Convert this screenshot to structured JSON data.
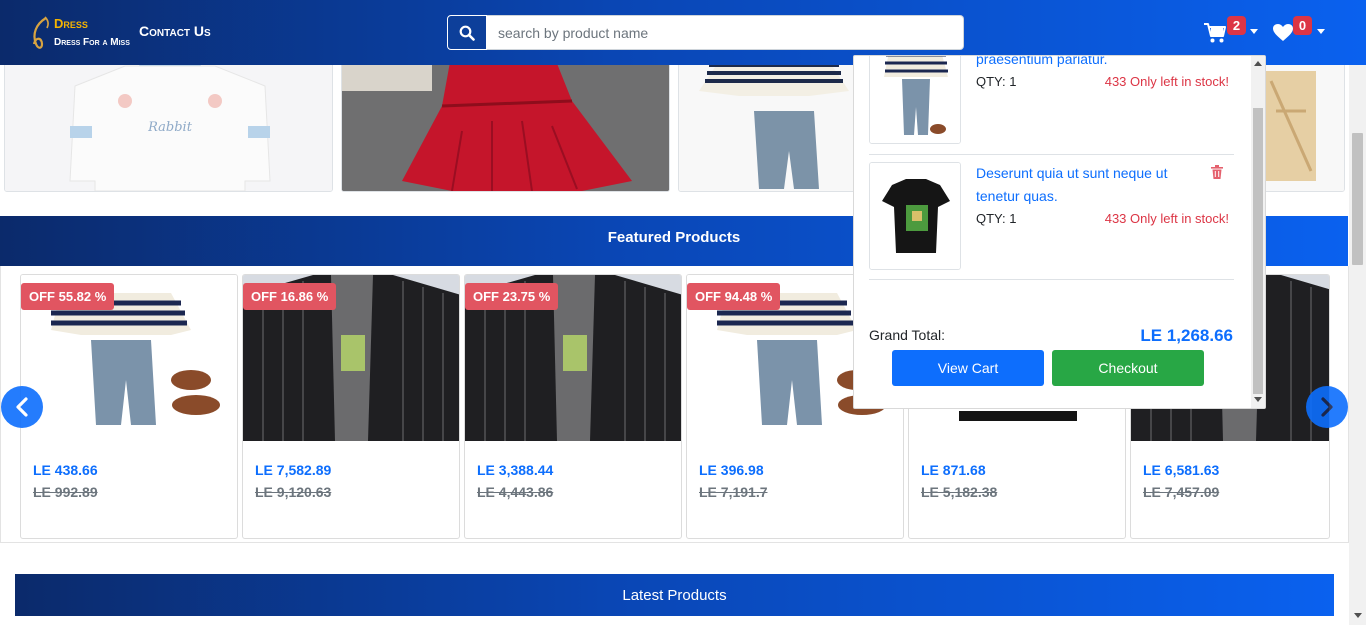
{
  "navbar": {
    "logo_title": "Dress",
    "logo_subtitle": "Dress For a Miss",
    "contact_link": "Contact Us",
    "search_placeholder": "search by product name",
    "cart_count": "2",
    "wishlist_count": "0"
  },
  "featured": {
    "title": "Featured Products",
    "products": [
      {
        "discount": "OFF 55.82 %",
        "price": "LE 438.66",
        "old_price": "LE 992.89",
        "image": "kids-outfit"
      },
      {
        "discount": "OFF 16.86 %",
        "price": "LE 7,582.89",
        "old_price": "LE 9,120.63",
        "image": "pinstripe-blazer"
      },
      {
        "discount": "OFF 23.75 %",
        "price": "LE 3,388.44",
        "old_price": "LE 4,443.86",
        "image": "pinstripe-blazer"
      },
      {
        "discount": "OFF 94.48 %",
        "price": "LE 396.98",
        "old_price": "LE 7,191.7",
        "image": "kids-outfit"
      },
      {
        "discount": "",
        "price": "LE 871.68",
        "old_price": "LE 5,182.38",
        "image": "black-tshirt"
      },
      {
        "discount": "",
        "price": "LE 6,581.63",
        "old_price": "LE 7,457.09",
        "image": "pinstripe-blazer"
      }
    ]
  },
  "latest": {
    "title": "Latest Products"
  },
  "cart_dropdown": {
    "items": [
      {
        "name": "praesentium pariatur.",
        "qty": "QTY: 1",
        "stock": "433 Only left in stock!",
        "image": "kids-outfit"
      },
      {
        "name": "Deserunt quia ut sunt neque ut tenetur quas.",
        "qty": "QTY: 1",
        "stock": "433 Only left in stock!",
        "image": "black-tshirt"
      }
    ],
    "grand_total_label": "Grand Total:",
    "grand_total_value": "LE 1,268.66",
    "view_cart_label": "View Cart",
    "checkout_label": "Checkout"
  },
  "colors": {
    "primary": "#0d6efd",
    "success": "#28a745",
    "danger": "#dc3545",
    "discount_badge": "#e15561",
    "logo_gold": "#f5b400"
  }
}
